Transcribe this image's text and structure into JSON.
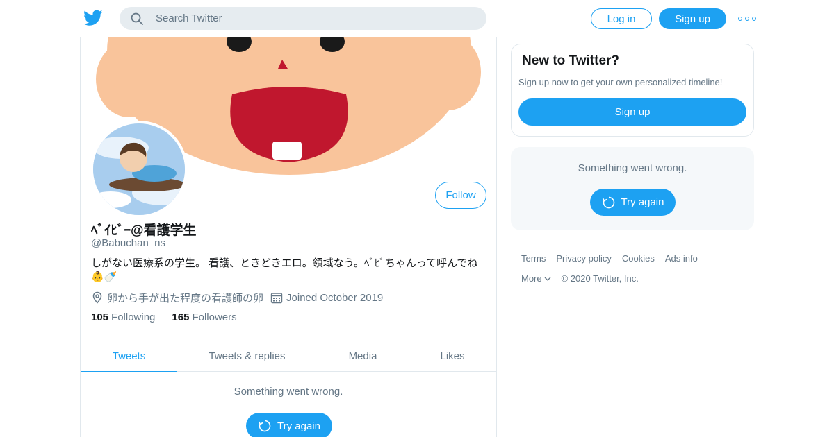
{
  "topbar": {
    "search_placeholder": "Search Twitter",
    "login_label": "Log in",
    "signup_label": "Sign up",
    "logo_icon": "twitter-bird-icon",
    "more_icon": "more-dots-icon"
  },
  "profile": {
    "display_name": "ﾍﾞｲﾋﾞｰ@看護学生",
    "screen_name": "@Babuchan_ns",
    "bio": "しがない医療系の学生。 看護、ときどきエロ。領域なう。ﾍﾞﾋﾞちゃんって呼んでね👶🍼",
    "location": "卵から手が出た程度の看護師の卵",
    "joined": "Joined October 2019",
    "following_count": "105",
    "following_label": "Following",
    "followers_count": "165",
    "followers_label": "Followers",
    "follow_label": "Follow"
  },
  "tabs": [
    {
      "label": "Tweets",
      "active": true
    },
    {
      "label": "Tweets & replies",
      "active": false
    },
    {
      "label": "Media",
      "active": false
    },
    {
      "label": "Likes",
      "active": false
    }
  ],
  "main_error": {
    "message": "Something went wrong.",
    "retry_label": "Try again"
  },
  "sidebar": {
    "new_title": "New to Twitter?",
    "new_subtitle": "Sign up now to get your own personalized timeline!",
    "signup_label": "Sign up",
    "error_message": "Something went wrong.",
    "retry_label": "Try again"
  },
  "footer": {
    "links": [
      "Terms",
      "Privacy policy",
      "Cookies",
      "Ads info"
    ],
    "more_label": "More",
    "copyright": "© 2020 Twitter, Inc."
  },
  "colors": {
    "accent": "#1da1f2",
    "muted": "#657786",
    "text": "#14171a",
    "border": "#e1e8ed",
    "banner_face": "#f9c49b",
    "banner_mouth": "#c0172e"
  }
}
